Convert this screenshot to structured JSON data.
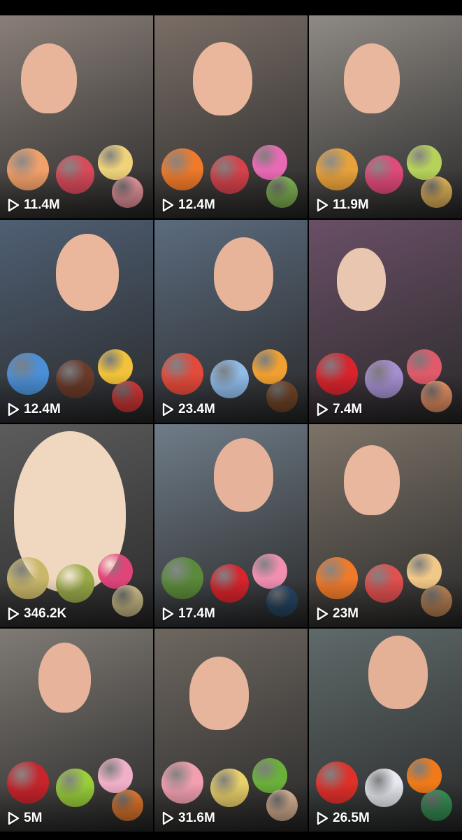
{
  "videos": [
    {
      "views": "11.4M",
      "bg": "#8a7f78",
      "accent": "#e8b49a",
      "foods": [
        "#f2a06a",
        "#d94a5a",
        "#efd27a",
        "#f5a0a8"
      ]
    },
    {
      "views": "12.4M",
      "bg": "#7a6e66",
      "accent": "#eab79c",
      "foods": [
        "#ef7a2a",
        "#d6424c",
        "#e86ab4",
        "#8ac05a"
      ]
    },
    {
      "views": "11.9M",
      "bg": "#8f8a84",
      "accent": "#e9b79d",
      "foods": [
        "#e9a23a",
        "#e24a7a",
        "#b7d25a",
        "#f0c060"
      ]
    },
    {
      "views": "12.4M",
      "bg": "#4f5f74",
      "accent": "#eab79c",
      "foods": [
        "#4b8fd6",
        "#6a3a2a",
        "#f2c23a",
        "#e03a3a"
      ]
    },
    {
      "views": "23.4M",
      "bg": "#5b6b7e",
      "accent": "#e7b49a",
      "foods": [
        "#e34a3a",
        "#8fbbe8",
        "#f0a030",
        "#7a4a2a"
      ]
    },
    {
      "views": "7.4M",
      "bg": "#6a4f66",
      "accent": "#e9c6b0",
      "foods": [
        "#d8242c",
        "#a48fcf",
        "#e05a6a",
        "#f29a6a"
      ]
    },
    {
      "views": "346.2K",
      "bg": "#5c5c5c",
      "accent": "#f0d8c0",
      "foods": [
        "#c9b86a",
        "#9aaa4a",
        "#e0457a",
        "#d8c890"
      ]
    },
    {
      "views": "17.4M",
      "bg": "#6f7c88",
      "accent": "#e6b39a",
      "foods": [
        "#5a8a3a",
        "#d8242c",
        "#f08fb0",
        "#2a4a6a"
      ]
    },
    {
      "views": "23M",
      "bg": "#7d7368",
      "accent": "#e9b79d",
      "foods": [
        "#f07a2a",
        "#e25050",
        "#f0c888",
        "#c48a5a"
      ]
    },
    {
      "views": "5M",
      "bg": "#7f7a74",
      "accent": "#e8b39b",
      "foods": [
        "#c8242c",
        "#9acf3a",
        "#f0b0c8",
        "#f08030"
      ]
    },
    {
      "views": "31.6M",
      "bg": "#6e6760",
      "accent": "#e6b59c",
      "foods": [
        "#f2a0b0",
        "#e8d06a",
        "#6ab03a",
        "#e8c0a0"
      ]
    },
    {
      "views": "26.5M",
      "bg": "#5f6a6a",
      "accent": "#e4b096",
      "foods": [
        "#e0302a",
        "#e8e8f0",
        "#f07a1a",
        "#3a9a5a"
      ]
    }
  ]
}
